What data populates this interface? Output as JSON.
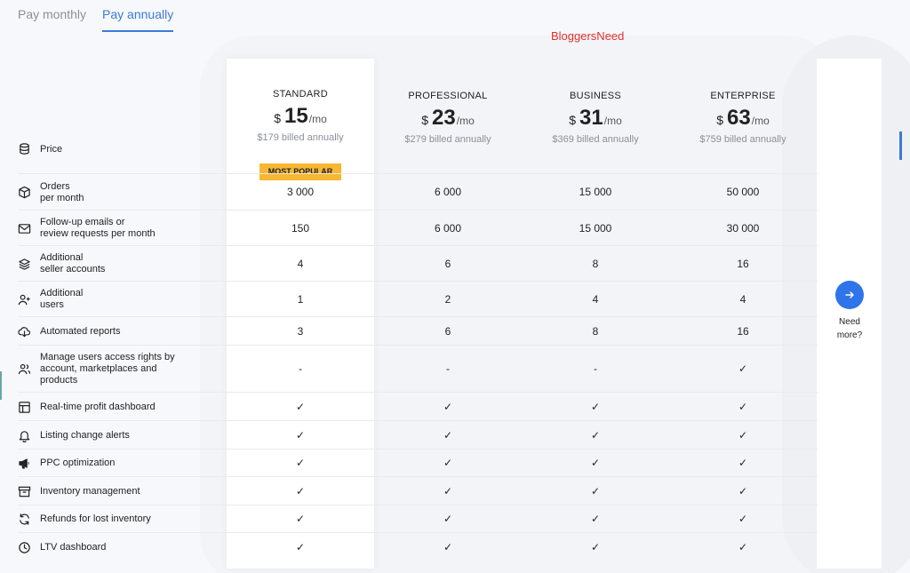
{
  "tabs": [
    "Pay monthly",
    "Pay annually"
  ],
  "watermark": "BloggersNeed",
  "plans": [
    {
      "name": "STANDARD",
      "currency": "$",
      "price": "15",
      "per": "/mo",
      "billed": "$179 billed annually"
    },
    {
      "name": "PROFESSIONAL",
      "currency": "$",
      "price": "23",
      "per": "/mo",
      "billed": "$279 billed annually"
    },
    {
      "name": "BUSINESS",
      "currency": "$",
      "price": "31",
      "per": "/mo",
      "billed": "$369 billed annually"
    },
    {
      "name": "ENTERPRISE",
      "currency": "$",
      "price": "63",
      "per": "/mo",
      "billed": "$759 billed annually"
    }
  ],
  "badge": "MOST POPULAR",
  "price_label": "Price",
  "features": [
    {
      "label": [
        "Orders",
        "per month"
      ],
      "icon": "box-icon",
      "values": [
        "3 000",
        "6 000",
        "15 000",
        "50 000"
      ]
    },
    {
      "label": [
        "Follow-up emails or",
        "review requests per month"
      ],
      "icon": "mail-icon",
      "values": [
        "150",
        "6 000",
        "15 000",
        "30 000"
      ]
    },
    {
      "label": [
        "Additional",
        "seller accounts"
      ],
      "icon": "layers-icon",
      "values": [
        "4",
        "6",
        "8",
        "16"
      ]
    },
    {
      "label": [
        "Additional",
        "users"
      ],
      "icon": "user-plus-icon",
      "values": [
        "1",
        "2",
        "4",
        "4"
      ]
    },
    {
      "label": [
        "Automated reports"
      ],
      "icon": "cloud-download-icon",
      "values": [
        "3",
        "6",
        "8",
        "16"
      ]
    },
    {
      "label": [
        "Manage users access rights by",
        "account, marketplaces and",
        "products"
      ],
      "icon": "users-icon",
      "values": [
        "-",
        "-",
        "-",
        "✓"
      ]
    },
    {
      "label": [
        "Real-time profit dashboard"
      ],
      "icon": "dashboard-icon",
      "values": [
        "✓",
        "✓",
        "✓",
        "✓"
      ]
    },
    {
      "label": [
        "Listing change alerts"
      ],
      "icon": "bell-icon",
      "values": [
        "✓",
        "✓",
        "✓",
        "✓"
      ]
    },
    {
      "label": [
        "PPC optimization"
      ],
      "icon": "megaphone-icon",
      "values": [
        "✓",
        "✓",
        "✓",
        "✓"
      ]
    },
    {
      "label": [
        "Inventory management"
      ],
      "icon": "archive-icon",
      "values": [
        "✓",
        "✓",
        "✓",
        "✓"
      ]
    },
    {
      "label": [
        "Refunds for lost inventory"
      ],
      "icon": "refresh-icon",
      "values": [
        "✓",
        "✓",
        "✓",
        "✓"
      ]
    },
    {
      "label": [
        "LTV dashboard"
      ],
      "icon": "clock-icon",
      "values": [
        "✓",
        "✓",
        "✓",
        "✓"
      ]
    }
  ],
  "need_more": [
    "Need",
    "more?"
  ],
  "colors": {
    "accent": "#3b7bd6",
    "badge": "#f7b733",
    "button": "#2f74e8",
    "watermark": "#e0302a"
  }
}
